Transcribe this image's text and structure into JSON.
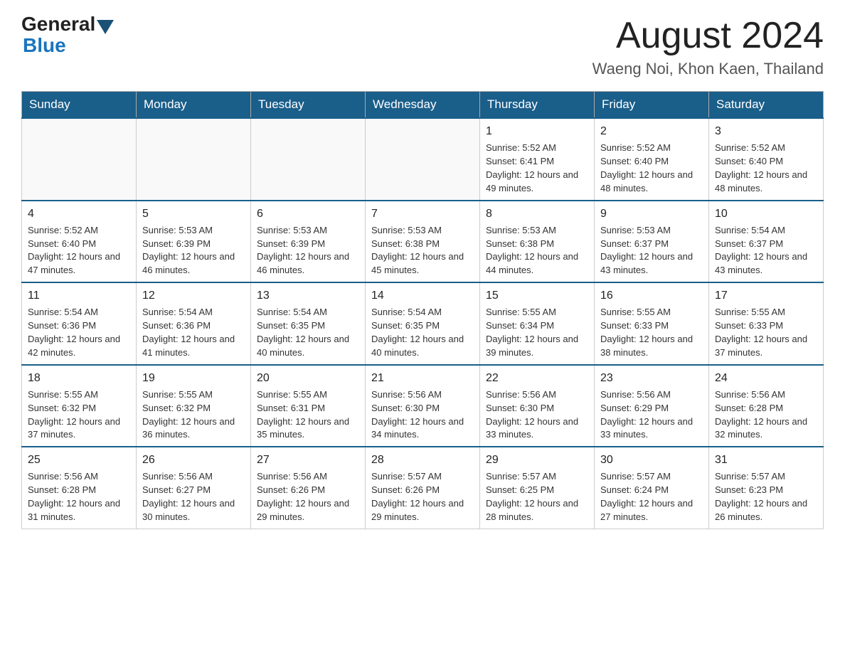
{
  "header": {
    "logo_general": "General",
    "logo_blue": "Blue",
    "main_title": "August 2024",
    "subtitle": "Waeng Noi, Khon Kaen, Thailand"
  },
  "days_of_week": [
    "Sunday",
    "Monday",
    "Tuesday",
    "Wednesday",
    "Thursday",
    "Friday",
    "Saturday"
  ],
  "weeks": [
    [
      {
        "day": "",
        "info": ""
      },
      {
        "day": "",
        "info": ""
      },
      {
        "day": "",
        "info": ""
      },
      {
        "day": "",
        "info": ""
      },
      {
        "day": "1",
        "info": "Sunrise: 5:52 AM\nSunset: 6:41 PM\nDaylight: 12 hours and 49 minutes."
      },
      {
        "day": "2",
        "info": "Sunrise: 5:52 AM\nSunset: 6:40 PM\nDaylight: 12 hours and 48 minutes."
      },
      {
        "day": "3",
        "info": "Sunrise: 5:52 AM\nSunset: 6:40 PM\nDaylight: 12 hours and 48 minutes."
      }
    ],
    [
      {
        "day": "4",
        "info": "Sunrise: 5:52 AM\nSunset: 6:40 PM\nDaylight: 12 hours and 47 minutes."
      },
      {
        "day": "5",
        "info": "Sunrise: 5:53 AM\nSunset: 6:39 PM\nDaylight: 12 hours and 46 minutes."
      },
      {
        "day": "6",
        "info": "Sunrise: 5:53 AM\nSunset: 6:39 PM\nDaylight: 12 hours and 46 minutes."
      },
      {
        "day": "7",
        "info": "Sunrise: 5:53 AM\nSunset: 6:38 PM\nDaylight: 12 hours and 45 minutes."
      },
      {
        "day": "8",
        "info": "Sunrise: 5:53 AM\nSunset: 6:38 PM\nDaylight: 12 hours and 44 minutes."
      },
      {
        "day": "9",
        "info": "Sunrise: 5:53 AM\nSunset: 6:37 PM\nDaylight: 12 hours and 43 minutes."
      },
      {
        "day": "10",
        "info": "Sunrise: 5:54 AM\nSunset: 6:37 PM\nDaylight: 12 hours and 43 minutes."
      }
    ],
    [
      {
        "day": "11",
        "info": "Sunrise: 5:54 AM\nSunset: 6:36 PM\nDaylight: 12 hours and 42 minutes."
      },
      {
        "day": "12",
        "info": "Sunrise: 5:54 AM\nSunset: 6:36 PM\nDaylight: 12 hours and 41 minutes."
      },
      {
        "day": "13",
        "info": "Sunrise: 5:54 AM\nSunset: 6:35 PM\nDaylight: 12 hours and 40 minutes."
      },
      {
        "day": "14",
        "info": "Sunrise: 5:54 AM\nSunset: 6:35 PM\nDaylight: 12 hours and 40 minutes."
      },
      {
        "day": "15",
        "info": "Sunrise: 5:55 AM\nSunset: 6:34 PM\nDaylight: 12 hours and 39 minutes."
      },
      {
        "day": "16",
        "info": "Sunrise: 5:55 AM\nSunset: 6:33 PM\nDaylight: 12 hours and 38 minutes."
      },
      {
        "day": "17",
        "info": "Sunrise: 5:55 AM\nSunset: 6:33 PM\nDaylight: 12 hours and 37 minutes."
      }
    ],
    [
      {
        "day": "18",
        "info": "Sunrise: 5:55 AM\nSunset: 6:32 PM\nDaylight: 12 hours and 37 minutes."
      },
      {
        "day": "19",
        "info": "Sunrise: 5:55 AM\nSunset: 6:32 PM\nDaylight: 12 hours and 36 minutes."
      },
      {
        "day": "20",
        "info": "Sunrise: 5:55 AM\nSunset: 6:31 PM\nDaylight: 12 hours and 35 minutes."
      },
      {
        "day": "21",
        "info": "Sunrise: 5:56 AM\nSunset: 6:30 PM\nDaylight: 12 hours and 34 minutes."
      },
      {
        "day": "22",
        "info": "Sunrise: 5:56 AM\nSunset: 6:30 PM\nDaylight: 12 hours and 33 minutes."
      },
      {
        "day": "23",
        "info": "Sunrise: 5:56 AM\nSunset: 6:29 PM\nDaylight: 12 hours and 33 minutes."
      },
      {
        "day": "24",
        "info": "Sunrise: 5:56 AM\nSunset: 6:28 PM\nDaylight: 12 hours and 32 minutes."
      }
    ],
    [
      {
        "day": "25",
        "info": "Sunrise: 5:56 AM\nSunset: 6:28 PM\nDaylight: 12 hours and 31 minutes."
      },
      {
        "day": "26",
        "info": "Sunrise: 5:56 AM\nSunset: 6:27 PM\nDaylight: 12 hours and 30 minutes."
      },
      {
        "day": "27",
        "info": "Sunrise: 5:56 AM\nSunset: 6:26 PM\nDaylight: 12 hours and 29 minutes."
      },
      {
        "day": "28",
        "info": "Sunrise: 5:57 AM\nSunset: 6:26 PM\nDaylight: 12 hours and 29 minutes."
      },
      {
        "day": "29",
        "info": "Sunrise: 5:57 AM\nSunset: 6:25 PM\nDaylight: 12 hours and 28 minutes."
      },
      {
        "day": "30",
        "info": "Sunrise: 5:57 AM\nSunset: 6:24 PM\nDaylight: 12 hours and 27 minutes."
      },
      {
        "day": "31",
        "info": "Sunrise: 5:57 AM\nSunset: 6:23 PM\nDaylight: 12 hours and 26 minutes."
      }
    ]
  ]
}
